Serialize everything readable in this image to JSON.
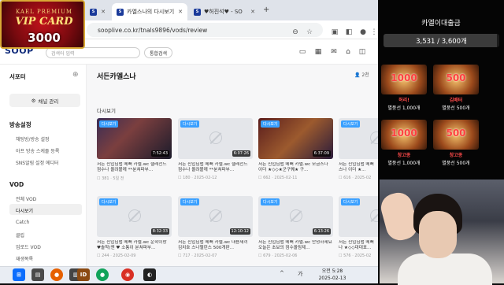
{
  "browser": {
    "tabs": [
      {
        "label": "",
        "icon": "soop-icon"
      },
      {
        "label": "카엘스나의 다시보기",
        "icon": "soop-icon",
        "active": true
      },
      {
        "label": "♥허진석♥ - SO",
        "icon": "soop-icon"
      }
    ],
    "url": "sooplive.co.kr/tnals9896/vods/review"
  },
  "site": {
    "logo": "SOOP",
    "search_placeholder": "검색어 입력",
    "search_button": "통합검색"
  },
  "sidebar": {
    "streamer_heading": "서포터",
    "manage_button": "채널 관리",
    "broadcast_heading": "방송설정",
    "broadcast_items": [
      "채팅방/방송 설정",
      "아프 방송 스케줄 등록",
      "SNS알림 설정 에디터"
    ],
    "vod_heading": "VOD",
    "vod_items": [
      "전체 VOD",
      "다시보기",
      "Catch",
      "클립",
      "업로드 VOD",
      "재생목록"
    ]
  },
  "main": {
    "channel_title": "서든카엘스나",
    "subscribers": "2천",
    "section_title": "다시보기",
    "cards": [
      {
        "badge": "다시보기",
        "duration": "7:52:43",
        "title": "서든 신입님맵 메뻐 카엘.wc 헬레전드 점수나 올려볼께 **분쳐파부...",
        "meta": "☐ 381 · 5일 전",
        "thumb": "video"
      },
      {
        "badge": "다시보기",
        "duration": "6:07:26",
        "title": "서든 신입님맵 메뻐 카엘.wc 헬레전드 점수나 올려볼께 **분쳐파부...",
        "meta": "☐ 180 · 2025-02-12",
        "thumb": "empty"
      },
      {
        "badge": "다시보기",
        "duration": "6:37:09",
        "title": "서든 신입님맵 메뻐 카엘.wc 모금스나 이더 ★◇◇★군구퀘★ 구...",
        "meta": "☐ 662 · 2025-02-11",
        "thumb": "video2"
      },
      {
        "badge": "다시보기",
        "duration": "6:16",
        "title": "서든 신입님맵 메뻐 스나 이더 ★...",
        "meta": "☐ 616 · 2025-02",
        "thumb": "empty"
      },
      {
        "badge": "다시보기",
        "duration": "8:32:33",
        "title": "서든 신입님맵 메뻐 카엘.wc 운학이랑 ♥솔착(앤 ♥ 소통이 분쳐파부...",
        "meta": "☐ 244 · 2025-02-09",
        "thumb": "empty"
      },
      {
        "badge": "다시보기",
        "duration": "12:10:12",
        "title": "서든 신입님맵 메뻐 카엘.wc 대용새끼 김치호 스나헬런스 500개판...",
        "meta": "☐ 717 · 2025-02-07",
        "thumb": "empty"
      },
      {
        "badge": "다시보기",
        "duration": "6:13:26",
        "title": "서든 신입님맵 메뻐 카엘.wc 안녕하세요 오늘은 초보의 점수올림제...",
        "meta": "☐ 679 · 2025-02-06",
        "thumb": "empty"
      },
      {
        "badge": "다시보기",
        "duration": "",
        "title": "서든 신입님맵 메뻐 나 ★◇◇대대표...",
        "meta": "☐ 576 · 2025-02",
        "thumb": "empty"
      }
    ]
  },
  "taskbar": {
    "time": "오전 5:28",
    "date": "2025-02-13",
    "tray_ime": "가",
    "apps": [
      "windows-start-icon",
      "search-icon",
      "file-explorer-icon",
      "firefox-icon",
      "soop-app-icon",
      "10d-app-icon",
      "kakao-icon",
      "chrome-icon",
      "obs-icon"
    ]
  },
  "overlay": {
    "vip_line1": "KAEL PREMIUM",
    "vip_line2": "VIP CARD",
    "vip_amount": "3000",
    "goal_title": "카엘이대출금",
    "goal_current": 3531,
    "goal_target": 3600,
    "goal_text": "3,531 / 3,600개",
    "donors": [
      {
        "name": "허리!",
        "amount": "별풍선 1,000개",
        "center": "1000"
      },
      {
        "name": "김배터",
        "amount": "별풍선 500개",
        "center": "500"
      },
      {
        "name": "창고종",
        "amount": "별풍선 1,000개",
        "center": "1000"
      },
      {
        "name": "창고종",
        "amount": "별풍선 500개",
        "center": "500"
      }
    ]
  },
  "colors": {
    "accent": "#3aa0ff",
    "badge_red": "#c1121b",
    "gold": "#d9a935"
  }
}
